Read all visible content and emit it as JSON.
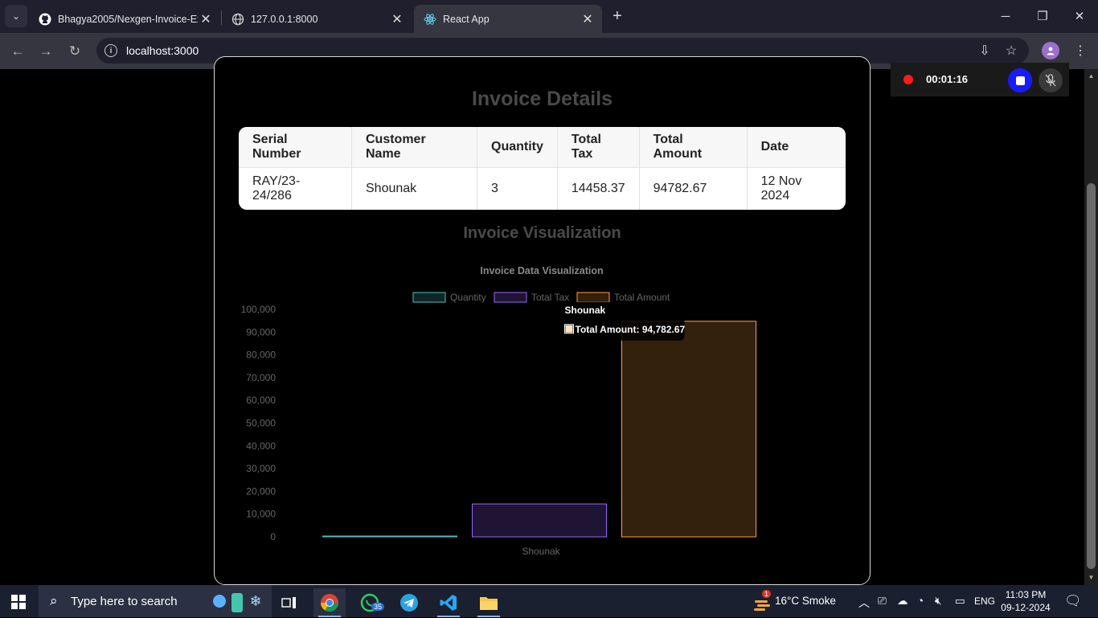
{
  "browser": {
    "tabs": [
      {
        "title": "Bhagya2005/Nexgen-Invoice-Ex",
        "icon": "github-icon"
      },
      {
        "title": "127.0.0.1:8000",
        "icon": "globe-icon"
      },
      {
        "title": "React App",
        "icon": "react-icon",
        "active": true
      }
    ],
    "url": "localhost:3000"
  },
  "recorder": {
    "time": "00:01:16"
  },
  "page": {
    "title": "Invoice Details",
    "table": {
      "headers": [
        "Serial Number",
        "Customer Name",
        "Quantity",
        "Total Tax",
        "Total Amount",
        "Date"
      ],
      "rows": [
        [
          "RAY/23-24/286",
          "Shounak",
          "3",
          "14458.37",
          "94782.67",
          "12 Nov 2024"
        ]
      ]
    },
    "viz_title": "Invoice Visualization"
  },
  "chart_data": {
    "type": "bar",
    "title": "Invoice Data Visualization",
    "categories": [
      "Shounak"
    ],
    "series": [
      {
        "name": "Quantity",
        "values": [
          3
        ],
        "color": "#4bc0c0"
      },
      {
        "name": "Total Tax",
        "values": [
          14458.37
        ],
        "color": "#9966ff"
      },
      {
        "name": "Total Amount",
        "values": [
          94782.67
        ],
        "color": "#ff9f40"
      }
    ],
    "ylim": [
      0,
      100000
    ],
    "yticks": [
      "100,000",
      "90,000",
      "80,000",
      "70,000",
      "60,000",
      "50,000",
      "40,000",
      "30,000",
      "20,000",
      "10,000",
      "0"
    ],
    "legend": "top",
    "tooltip": {
      "title": "Shounak",
      "label": "Total Amount: 94,782.67"
    }
  },
  "taskbar": {
    "search_placeholder": "Type here to search",
    "whatsapp_badge": "35",
    "weather_badge": "1",
    "weather": "16°C  Smoke",
    "language": "ENG",
    "time": "11:03 PM",
    "date": "09-12-2024"
  }
}
